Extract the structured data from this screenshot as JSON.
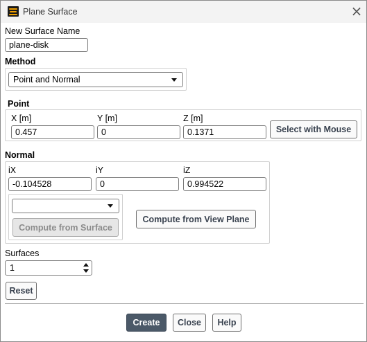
{
  "window": {
    "title": "Plane Surface"
  },
  "surface_name": {
    "label": "New Surface Name",
    "value": "plane-disk"
  },
  "method": {
    "label": "Method",
    "selected": "Point and Normal"
  },
  "point": {
    "label": "Point",
    "x": {
      "label": "X [m]",
      "value": "0.457"
    },
    "y": {
      "label": "Y [m]",
      "value": "0"
    },
    "z": {
      "label": "Z [m]",
      "value": "0.1371"
    },
    "select_button": "Select with Mouse"
  },
  "normal": {
    "label": "Normal",
    "ix": {
      "label": "iX",
      "value": "-0.104528"
    },
    "iy": {
      "label": "iY",
      "value": "0"
    },
    "iz": {
      "label": "iZ",
      "value": "0.994522"
    },
    "surface_select": "",
    "compute_surface_button": "Compute from Surface",
    "compute_view_button": "Compute from View Plane"
  },
  "surfaces": {
    "label": "Surfaces",
    "value": "1"
  },
  "reset_button": "Reset",
  "footer": {
    "create": "Create",
    "close": "Close",
    "help": "Help"
  },
  "colors": {
    "primary_button": "#4b5968",
    "disabled_button": "#e6e6e6",
    "accent_icon": "#f0a000"
  }
}
